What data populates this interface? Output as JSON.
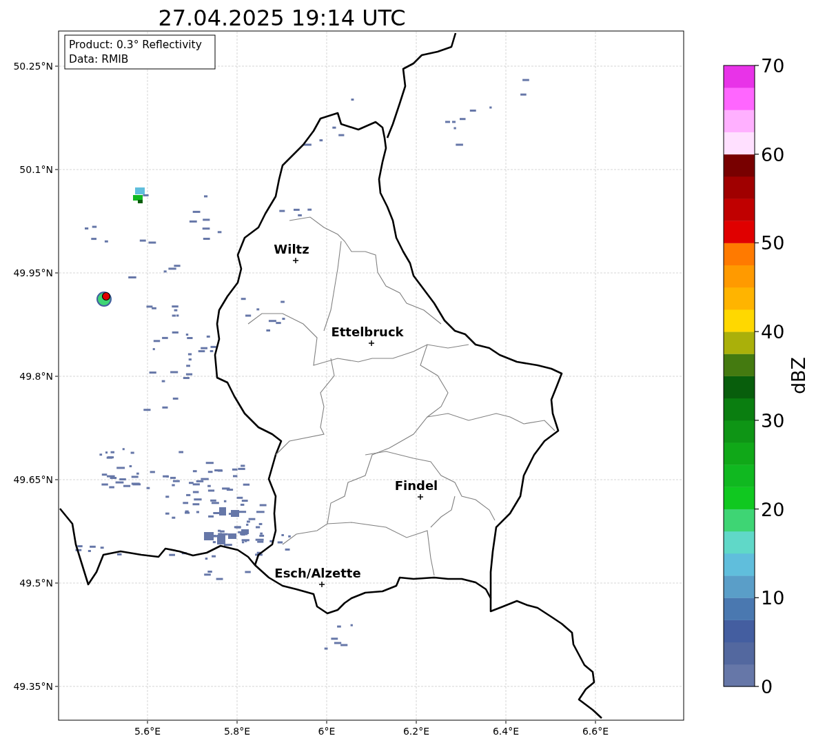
{
  "title": "27.04.2025 19:14 UTC",
  "info_box": [
    "Product: 0.3° Reflectivity",
    "Data: RMIB"
  ],
  "map": {
    "lat_ticks": [
      "50.25°N",
      "50.1°N",
      "49.95°N",
      "49.8°N",
      "49.65°N",
      "49.5°N",
      "49.35°N"
    ],
    "lon_ticks": [
      "5.6°E",
      "5.8°E",
      "6°E",
      "6.2°E",
      "6.4°E",
      "6.6°E"
    ],
    "cities": [
      "Wiltz",
      "Ettelbruck",
      "Findel",
      "Esch/Alzette"
    ]
  },
  "colorbar": {
    "label": "dBZ",
    "ticks": [
      "70",
      "60",
      "50",
      "40",
      "30",
      "20",
      "10",
      "0"
    ],
    "bins": [
      {
        "color": "#6677a8"
      },
      {
        "color": "#53689f"
      },
      {
        "color": "#445ea0"
      },
      {
        "color": "#4a78b0"
      },
      {
        "color": "#5a9ec8"
      },
      {
        "color": "#60bedc"
      },
      {
        "color": "#60d8c8"
      },
      {
        "color": "#3ed574"
      },
      {
        "color": "#10c820"
      },
      {
        "color": "#10b820"
      },
      {
        "color": "#10a818"
      },
      {
        "color": "#0e9515"
      },
      {
        "color": "#0a7e10"
      },
      {
        "color": "#085e0c"
      },
      {
        "color": "#447a10"
      },
      {
        "color": "#aab00a"
      },
      {
        "color": "#ffd800"
      },
      {
        "color": "#ffb400"
      },
      {
        "color": "#ff9a00"
      },
      {
        "color": "#ff7a00"
      },
      {
        "color": "#e00000"
      },
      {
        "color": "#c00000"
      },
      {
        "color": "#a00000"
      },
      {
        "color": "#780000"
      },
      {
        "color": "#ffe0ff"
      },
      {
        "color": "#ffb0ff"
      },
      {
        "color": "#ff66ff"
      },
      {
        "color": "#e833e8"
      }
    ]
  }
}
